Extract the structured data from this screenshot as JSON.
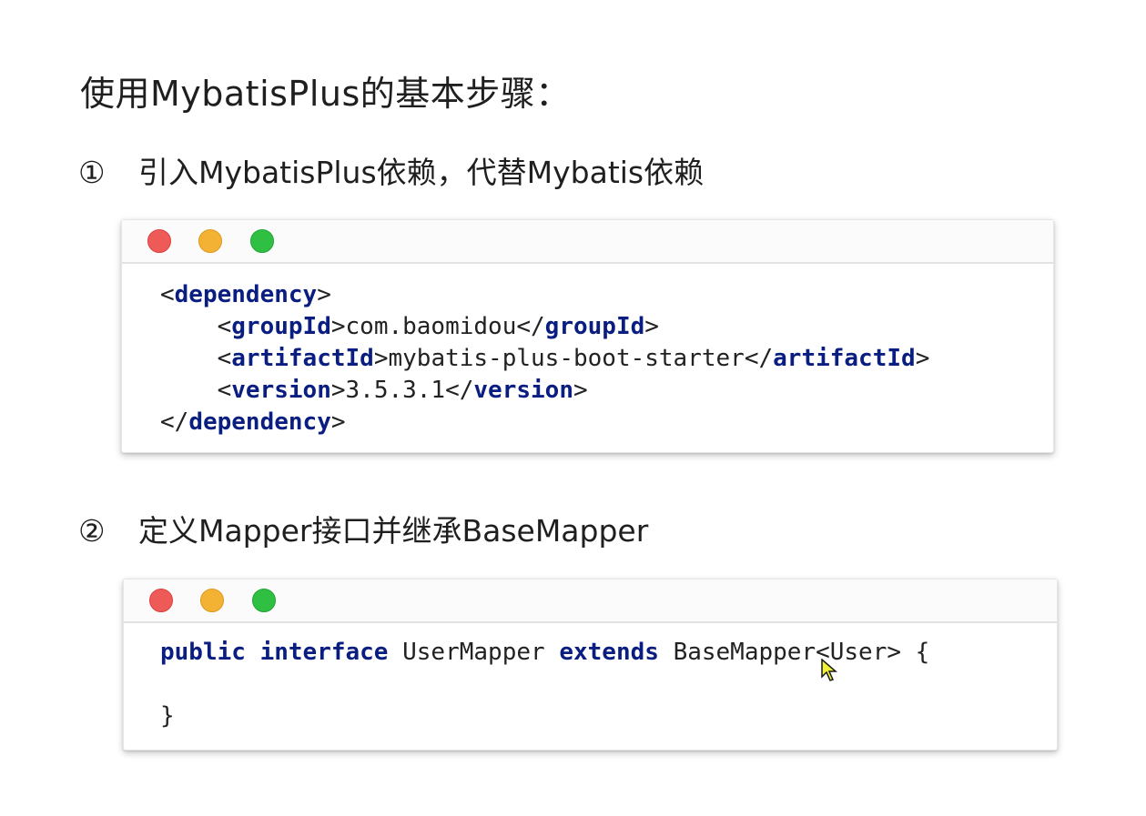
{
  "title": "使用MybatisPlus的基本步骤：",
  "steps": [
    {
      "number": "①",
      "text": "引入MybatisPlus依赖，代替Mybatis依赖"
    },
    {
      "number": "②",
      "text": "定义Mapper接口并继承BaseMapper"
    }
  ],
  "window_controls": {
    "close_color": "#ee5a57",
    "minimize_color": "#f4b234",
    "maximize_color": "#2fc043"
  },
  "code_block_1": {
    "open_dep_lt": "<",
    "dependency": "dependency",
    "gt": ">",
    "groupId": "groupId",
    "groupId_value": "com.baomidou",
    "artifactId": "artifactId",
    "artifactId_value": "mybatis-plus-boot-starter",
    "version": "version",
    "version_value": "3.5.3.1",
    "close_lt": "</"
  },
  "code_block_2": {
    "public": "public",
    "interface": "interface",
    "name": "UserMapper",
    "extends": "extends",
    "base": "BaseMapper<User>",
    "open_brace": "{",
    "close_brace": "}"
  },
  "colors": {
    "keyword": "#0a1d80",
    "text": "#222222"
  }
}
